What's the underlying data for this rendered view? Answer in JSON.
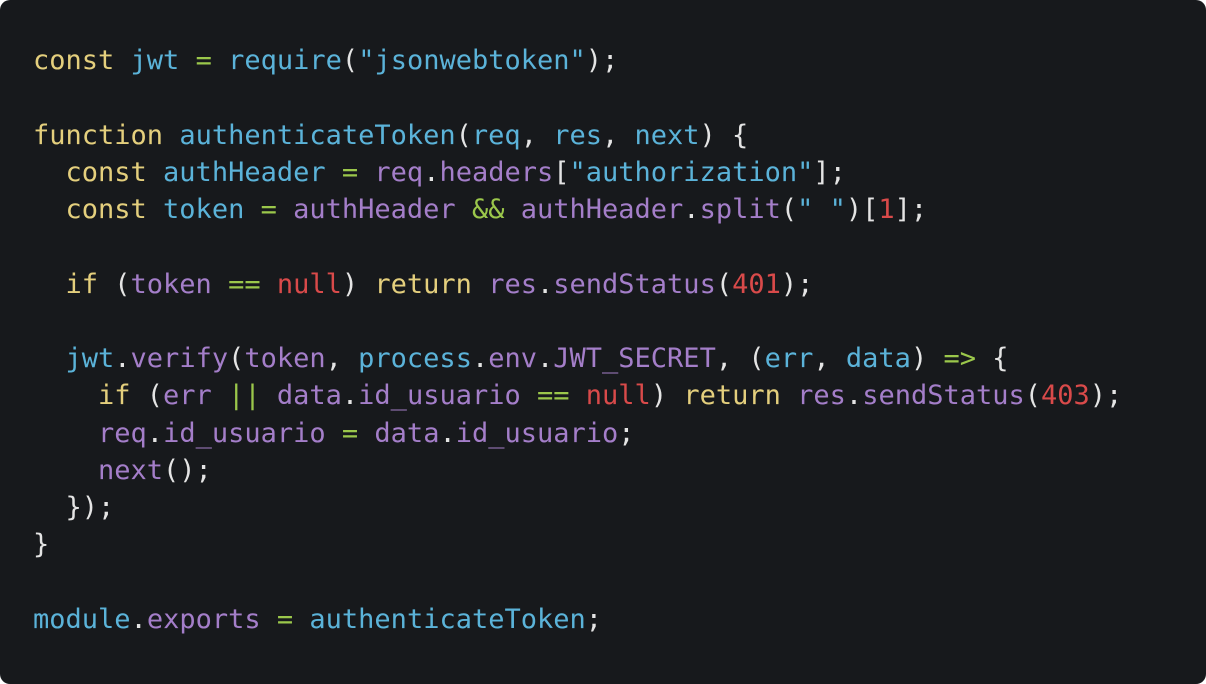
{
  "colors": {
    "background": "#17191c",
    "keyword": "#e4cf7d",
    "identifier": "#5bb3d9",
    "member": "#a47ec9",
    "string": "#5bb3d9",
    "number": "#d94a4a",
    "operator": "#9bc74b",
    "punctuation": "#e4e4e4"
  },
  "code_lines": [
    {
      "indent": 0,
      "tokens": [
        {
          "text": "const",
          "type": "keyword"
        },
        {
          "text": " ",
          "type": "punctuation"
        },
        {
          "text": "jwt",
          "type": "identifier"
        },
        {
          "text": " ",
          "type": "punctuation"
        },
        {
          "text": "=",
          "type": "operator"
        },
        {
          "text": " ",
          "type": "punctuation"
        },
        {
          "text": "require",
          "type": "identifier"
        },
        {
          "text": "(",
          "type": "punctuation"
        },
        {
          "text": "\"jsonwebtoken\"",
          "type": "string"
        },
        {
          "text": ");",
          "type": "punctuation"
        }
      ]
    },
    {
      "indent": 0,
      "tokens": []
    },
    {
      "indent": 0,
      "tokens": [
        {
          "text": "function",
          "type": "keyword"
        },
        {
          "text": " ",
          "type": "punctuation"
        },
        {
          "text": "authenticateToken",
          "type": "identifier"
        },
        {
          "text": "(",
          "type": "punctuation"
        },
        {
          "text": "req",
          "type": "identifier"
        },
        {
          "text": ", ",
          "type": "punctuation"
        },
        {
          "text": "res",
          "type": "identifier"
        },
        {
          "text": ", ",
          "type": "punctuation"
        },
        {
          "text": "next",
          "type": "identifier"
        },
        {
          "text": ") {",
          "type": "punctuation"
        }
      ]
    },
    {
      "indent": 1,
      "tokens": [
        {
          "text": "const",
          "type": "keyword"
        },
        {
          "text": " ",
          "type": "punctuation"
        },
        {
          "text": "authHeader",
          "type": "identifier"
        },
        {
          "text": " ",
          "type": "punctuation"
        },
        {
          "text": "=",
          "type": "operator"
        },
        {
          "text": " ",
          "type": "punctuation"
        },
        {
          "text": "req",
          "type": "member"
        },
        {
          "text": ".",
          "type": "punctuation"
        },
        {
          "text": "headers",
          "type": "member"
        },
        {
          "text": "[",
          "type": "punctuation"
        },
        {
          "text": "\"authorization\"",
          "type": "string"
        },
        {
          "text": "];",
          "type": "punctuation"
        }
      ]
    },
    {
      "indent": 1,
      "tokens": [
        {
          "text": "const",
          "type": "keyword"
        },
        {
          "text": " ",
          "type": "punctuation"
        },
        {
          "text": "token",
          "type": "identifier"
        },
        {
          "text": " ",
          "type": "punctuation"
        },
        {
          "text": "=",
          "type": "operator"
        },
        {
          "text": " ",
          "type": "punctuation"
        },
        {
          "text": "authHeader",
          "type": "member"
        },
        {
          "text": " ",
          "type": "punctuation"
        },
        {
          "text": "&&",
          "type": "operator"
        },
        {
          "text": " ",
          "type": "punctuation"
        },
        {
          "text": "authHeader",
          "type": "member"
        },
        {
          "text": ".",
          "type": "punctuation"
        },
        {
          "text": "split",
          "type": "member"
        },
        {
          "text": "(",
          "type": "punctuation"
        },
        {
          "text": "\" \"",
          "type": "string"
        },
        {
          "text": ")[",
          "type": "punctuation"
        },
        {
          "text": "1",
          "type": "number"
        },
        {
          "text": "];",
          "type": "punctuation"
        }
      ]
    },
    {
      "indent": 0,
      "tokens": []
    },
    {
      "indent": 1,
      "tokens": [
        {
          "text": "if",
          "type": "keyword"
        },
        {
          "text": " (",
          "type": "punctuation"
        },
        {
          "text": "token",
          "type": "member"
        },
        {
          "text": " ",
          "type": "punctuation"
        },
        {
          "text": "==",
          "type": "operator"
        },
        {
          "text": " ",
          "type": "punctuation"
        },
        {
          "text": "null",
          "type": "number"
        },
        {
          "text": ") ",
          "type": "punctuation"
        },
        {
          "text": "return",
          "type": "keyword"
        },
        {
          "text": " ",
          "type": "punctuation"
        },
        {
          "text": "res",
          "type": "member"
        },
        {
          "text": ".",
          "type": "punctuation"
        },
        {
          "text": "sendStatus",
          "type": "member"
        },
        {
          "text": "(",
          "type": "punctuation"
        },
        {
          "text": "401",
          "type": "number"
        },
        {
          "text": ");",
          "type": "punctuation"
        }
      ]
    },
    {
      "indent": 0,
      "tokens": []
    },
    {
      "indent": 1,
      "tokens": [
        {
          "text": "jwt",
          "type": "identifier"
        },
        {
          "text": ".",
          "type": "punctuation"
        },
        {
          "text": "verify",
          "type": "member"
        },
        {
          "text": "(",
          "type": "punctuation"
        },
        {
          "text": "token",
          "type": "member"
        },
        {
          "text": ", ",
          "type": "punctuation"
        },
        {
          "text": "process",
          "type": "identifier"
        },
        {
          "text": ".",
          "type": "punctuation"
        },
        {
          "text": "env",
          "type": "member"
        },
        {
          "text": ".",
          "type": "punctuation"
        },
        {
          "text": "JWT_SECRET",
          "type": "member"
        },
        {
          "text": ", (",
          "type": "punctuation"
        },
        {
          "text": "err",
          "type": "identifier"
        },
        {
          "text": ", ",
          "type": "punctuation"
        },
        {
          "text": "data",
          "type": "identifier"
        },
        {
          "text": ") ",
          "type": "punctuation"
        },
        {
          "text": "=>",
          "type": "operator"
        },
        {
          "text": " {",
          "type": "punctuation"
        }
      ]
    },
    {
      "indent": 2,
      "tokens": [
        {
          "text": "if",
          "type": "keyword"
        },
        {
          "text": " (",
          "type": "punctuation"
        },
        {
          "text": "err",
          "type": "member"
        },
        {
          "text": " ",
          "type": "punctuation"
        },
        {
          "text": "||",
          "type": "operator"
        },
        {
          "text": " ",
          "type": "punctuation"
        },
        {
          "text": "data",
          "type": "member"
        },
        {
          "text": ".",
          "type": "punctuation"
        },
        {
          "text": "id_usuario",
          "type": "member"
        },
        {
          "text": " ",
          "type": "punctuation"
        },
        {
          "text": "==",
          "type": "operator"
        },
        {
          "text": " ",
          "type": "punctuation"
        },
        {
          "text": "null",
          "type": "number"
        },
        {
          "text": ") ",
          "type": "punctuation"
        },
        {
          "text": "return",
          "type": "keyword"
        },
        {
          "text": " ",
          "type": "punctuation"
        },
        {
          "text": "res",
          "type": "member"
        },
        {
          "text": ".",
          "type": "punctuation"
        },
        {
          "text": "sendStatus",
          "type": "member"
        },
        {
          "text": "(",
          "type": "punctuation"
        },
        {
          "text": "403",
          "type": "number"
        },
        {
          "text": ");",
          "type": "punctuation"
        }
      ]
    },
    {
      "indent": 2,
      "tokens": [
        {
          "text": "req",
          "type": "member"
        },
        {
          "text": ".",
          "type": "punctuation"
        },
        {
          "text": "id_usuario",
          "type": "member"
        },
        {
          "text": " ",
          "type": "punctuation"
        },
        {
          "text": "=",
          "type": "operator"
        },
        {
          "text": " ",
          "type": "punctuation"
        },
        {
          "text": "data",
          "type": "member"
        },
        {
          "text": ".",
          "type": "punctuation"
        },
        {
          "text": "id_usuario",
          "type": "member"
        },
        {
          "text": ";",
          "type": "punctuation"
        }
      ]
    },
    {
      "indent": 2,
      "tokens": [
        {
          "text": "next",
          "type": "member"
        },
        {
          "text": "();",
          "type": "punctuation"
        }
      ]
    },
    {
      "indent": 1,
      "tokens": [
        {
          "text": "});",
          "type": "punctuation"
        }
      ]
    },
    {
      "indent": 0,
      "tokens": [
        {
          "text": "}",
          "type": "punctuation"
        }
      ]
    },
    {
      "indent": 0,
      "tokens": []
    },
    {
      "indent": 0,
      "tokens": [
        {
          "text": "module",
          "type": "identifier"
        },
        {
          "text": ".",
          "type": "punctuation"
        },
        {
          "text": "exports",
          "type": "member"
        },
        {
          "text": " ",
          "type": "punctuation"
        },
        {
          "text": "=",
          "type": "operator"
        },
        {
          "text": " ",
          "type": "punctuation"
        },
        {
          "text": "authenticateToken",
          "type": "identifier"
        },
        {
          "text": ";",
          "type": "punctuation"
        }
      ]
    }
  ]
}
